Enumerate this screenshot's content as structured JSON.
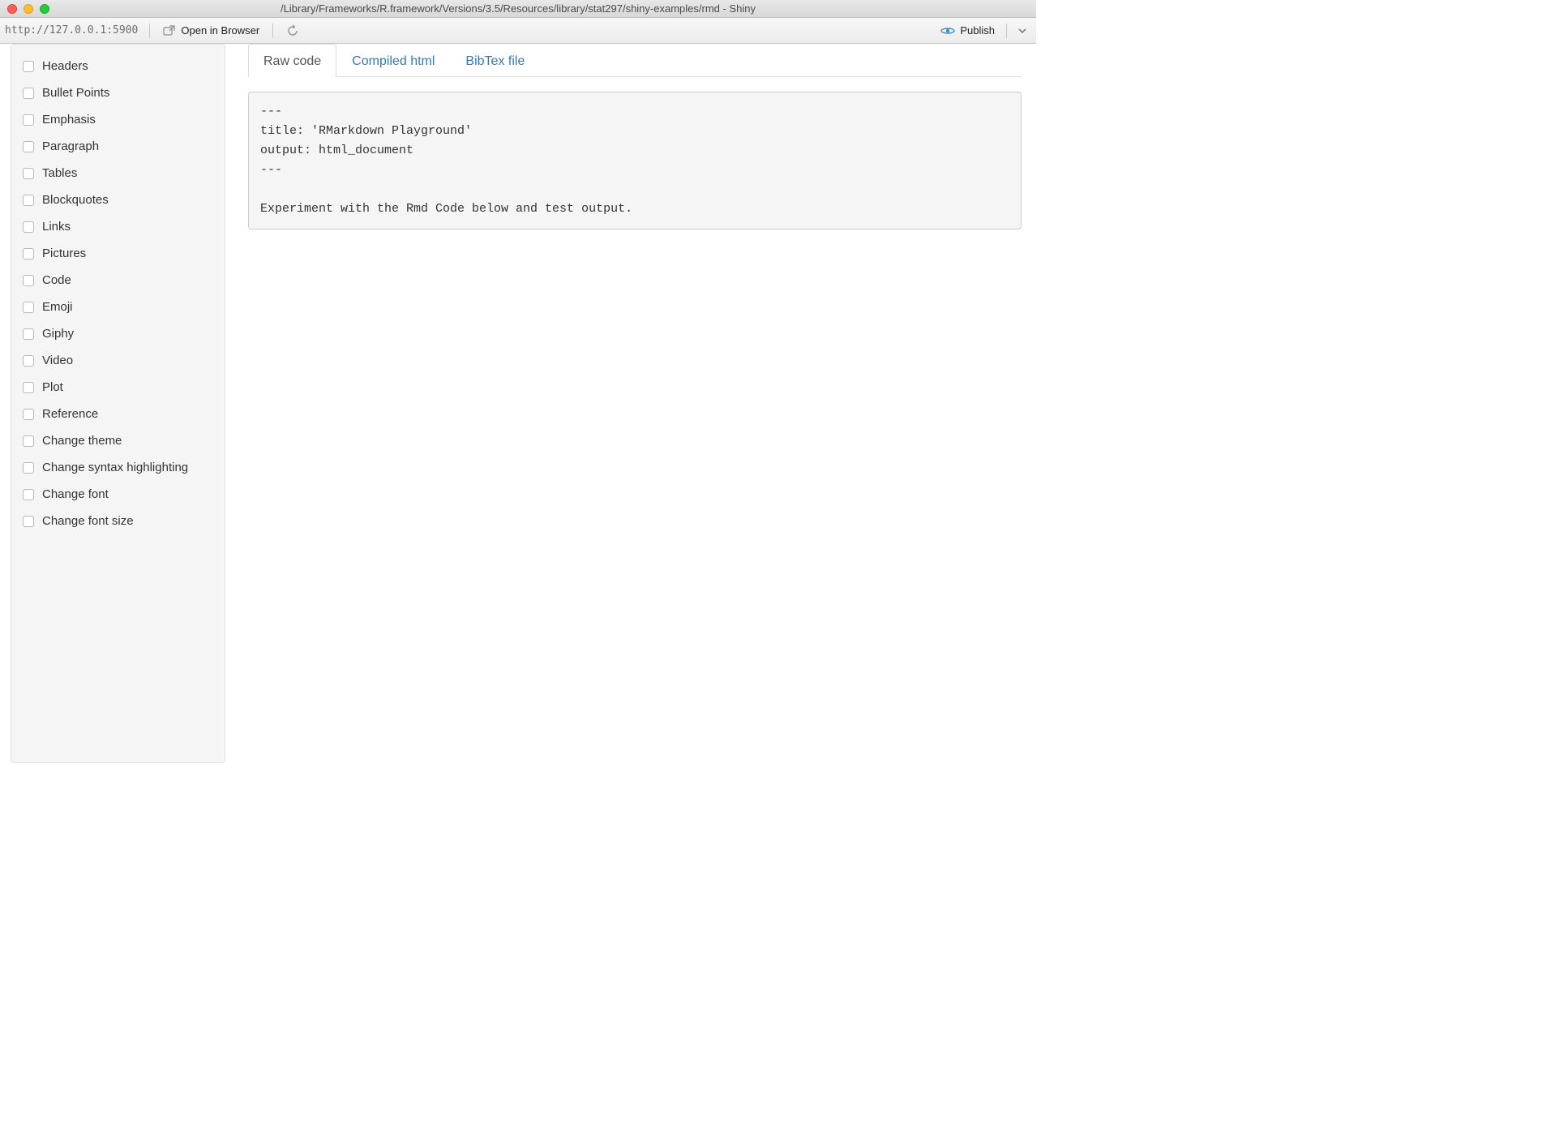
{
  "window": {
    "title": "/Library/Frameworks/R.framework/Versions/3.5/Resources/library/stat297/shiny-examples/rmd - Shiny"
  },
  "toolbar": {
    "url": "http://127.0.0.1:5900",
    "open_browser_label": "Open in Browser",
    "publish_label": "Publish"
  },
  "sidebar": {
    "items": [
      {
        "label": "Headers"
      },
      {
        "label": "Bullet Points"
      },
      {
        "label": "Emphasis"
      },
      {
        "label": "Paragraph"
      },
      {
        "label": "Tables"
      },
      {
        "label": "Blockquotes"
      },
      {
        "label": "Links"
      },
      {
        "label": "Pictures"
      },
      {
        "label": "Code"
      },
      {
        "label": "Emoji"
      },
      {
        "label": "Giphy"
      },
      {
        "label": "Video"
      },
      {
        "label": "Plot"
      },
      {
        "label": "Reference"
      },
      {
        "label": "Change theme"
      },
      {
        "label": "Change syntax highlighting"
      },
      {
        "label": "Change font"
      },
      {
        "label": "Change font size"
      }
    ]
  },
  "main": {
    "tabs": [
      {
        "label": "Raw code",
        "active": true
      },
      {
        "label": "Compiled html",
        "active": false
      },
      {
        "label": "BibTex file",
        "active": false
      }
    ],
    "code": "---\ntitle: 'RMarkdown Playground'\noutput: html_document\n---\n\nExperiment with the Rmd Code below and test output."
  }
}
